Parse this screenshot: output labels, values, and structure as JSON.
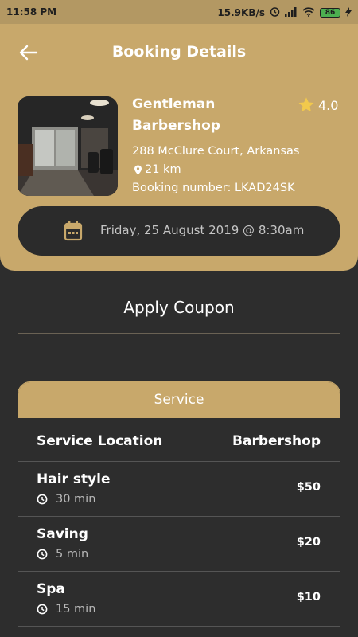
{
  "status_bar": {
    "time": "11:58 PM",
    "net_speed": "15.9KB/s",
    "battery": "86"
  },
  "header": {
    "title": "Booking Details"
  },
  "shop": {
    "name_line1": "Gentleman",
    "name_line2": "Barbershop",
    "rating": "4.0",
    "address": "288 McClure Court, Arkansas",
    "distance": "21 km",
    "booking_number": "Booking number: LKAD24SK"
  },
  "booking": {
    "datetime": "Friday, 25 August 2019 @ 8:30am"
  },
  "coupon": {
    "label": "Apply Coupon"
  },
  "service": {
    "title": "Service",
    "location_label": "Service Location",
    "location_value": "Barbershop",
    "items": [
      {
        "name": "Hair style",
        "duration": "30 min",
        "price": "$50"
      },
      {
        "name": "Saving",
        "duration": "5 min",
        "price": "$20"
      },
      {
        "name": "Spa",
        "duration": "15 min",
        "price": "$10"
      }
    ]
  },
  "colors": {
    "accent": "#c8a86b",
    "background": "#2d2d2d",
    "pill": "#2b2b2b",
    "star": "#f2c94c"
  }
}
